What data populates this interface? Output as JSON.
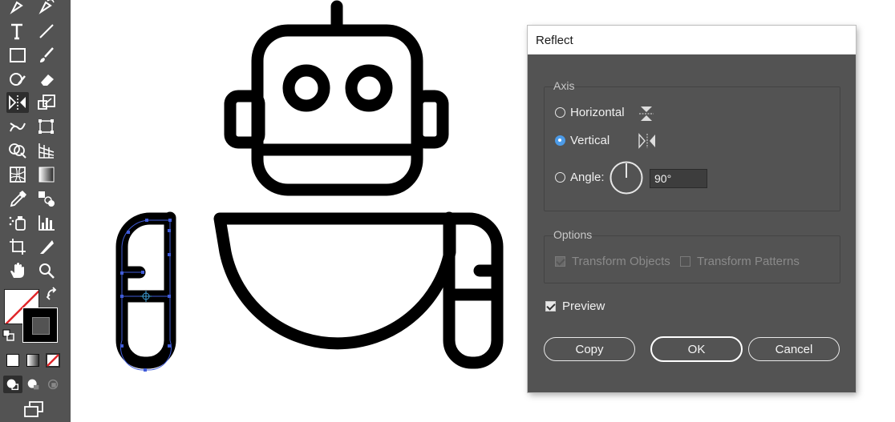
{
  "dialog": {
    "title": "Reflect",
    "axis": {
      "label": "Axis",
      "horizontal": "Horizontal",
      "vertical": "Vertical",
      "angle": "Angle:",
      "selected": "vertical",
      "angle_value": "90°"
    },
    "options": {
      "label": "Options",
      "transform_objects": "Transform Objects",
      "transform_patterns": "Transform Patterns",
      "transform_objects_checked": true,
      "transform_patterns_checked": false,
      "enabled": false
    },
    "preview": {
      "label": "Preview",
      "checked": true
    },
    "buttons": {
      "copy": "Copy",
      "ok": "OK",
      "cancel": "Cancel"
    }
  },
  "toolbar": {
    "tools": [
      "pen-icon",
      "curvature-icon",
      "type-icon",
      "line-icon",
      "rectangle-icon",
      "paintbrush-icon",
      "shaper-icon",
      "eraser-icon",
      "reflect-icon",
      "scale-icon",
      "warp-icon",
      "free-transform-icon",
      "shape-builder-icon",
      "perspective-grid-icon",
      "mesh-icon",
      "gradient-icon",
      "eyedropper-icon",
      "blend-icon",
      "symbol-sprayer-icon",
      "column-graph-icon",
      "artboard-icon",
      "slice-icon",
      "hand-icon",
      "zoom-icon"
    ],
    "active_tool": "reflect-icon"
  },
  "colors": {
    "dialog_bg": "#535353",
    "toolbar_bg": "#535353",
    "accent": "#4c9be8",
    "selection": "#3f5bd8"
  }
}
